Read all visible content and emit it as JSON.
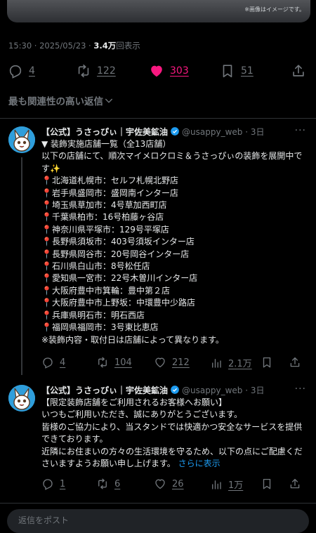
{
  "tweet": {
    "image_caption": "※画像はイメージです。",
    "time": "15:30 · 2025/05/23 · ",
    "views_count": "3.4万",
    "views_label": "回表示",
    "replies": "4",
    "retweets": "122",
    "likes": "303",
    "bookmarks": "51"
  },
  "sort_label": "最も関連性の高い返信",
  "replies": [
    {
      "name": "【公式】うさっぴぃ｜宇佐美鉱油",
      "handle": "@usappy_web · 3日",
      "text": "▼ 装飾実施店舗一覧（全13店舗）\n以下の店舗にて、順次マイメロクロミ＆うさっぴぃの装飾を展開中です✨\n📍北海道札幌市：セルフ札幌北野店\n📍岩手県盛岡市：盛岡南インター店\n📍埼玉県草加市：4号草加西町店\n📍千葉県柏市：16号柏藤ヶ谷店\n📍神奈川県平塚市：129号平塚店\n📍長野県須坂市：403号須坂インター店\n📍長野県岡谷市：20号岡谷インター店\n📍石川県白山市：8号松任店\n📍愛知県一宮市：22号木曽川インター店\n📍大阪府豊中市箕輪：豊中第２店\n📍大阪府豊中市上野坂：中環豊中少路店\n📍兵庫県明石市：明石西店\n📍福岡県福岡市：3号東比恵店\n※装飾内容・取付日は店舗によって異なります。",
      "replies": "4",
      "retweets": "104",
      "likes": "212",
      "views": "2.1万"
    },
    {
      "name": "【公式】うさっぴぃ｜宇佐美鉱油",
      "handle": "@usappy_web · 3日",
      "text": "【限定装飾店舗をご利用されるお客様へお願い】\nいつもご利用いただき、誠にありがとうございます。\n皆様のご協力により、当スタンドでは快適かつ安全なサービスを提供できております。\n近隣にお住まいの方々の生活環境を守るため、以下の点にご配慮くださいますようお願い申し上げます。 ",
      "show_more": "さらに表示",
      "replies": "1",
      "retweets": "6",
      "likes": "26",
      "views": "1万"
    }
  ],
  "compose_placeholder": "返信をポスト",
  "colors": {
    "like": "#f91880",
    "link": "#1d9bf0",
    "muted": "#71767b",
    "verified": "#1d9bf0"
  }
}
